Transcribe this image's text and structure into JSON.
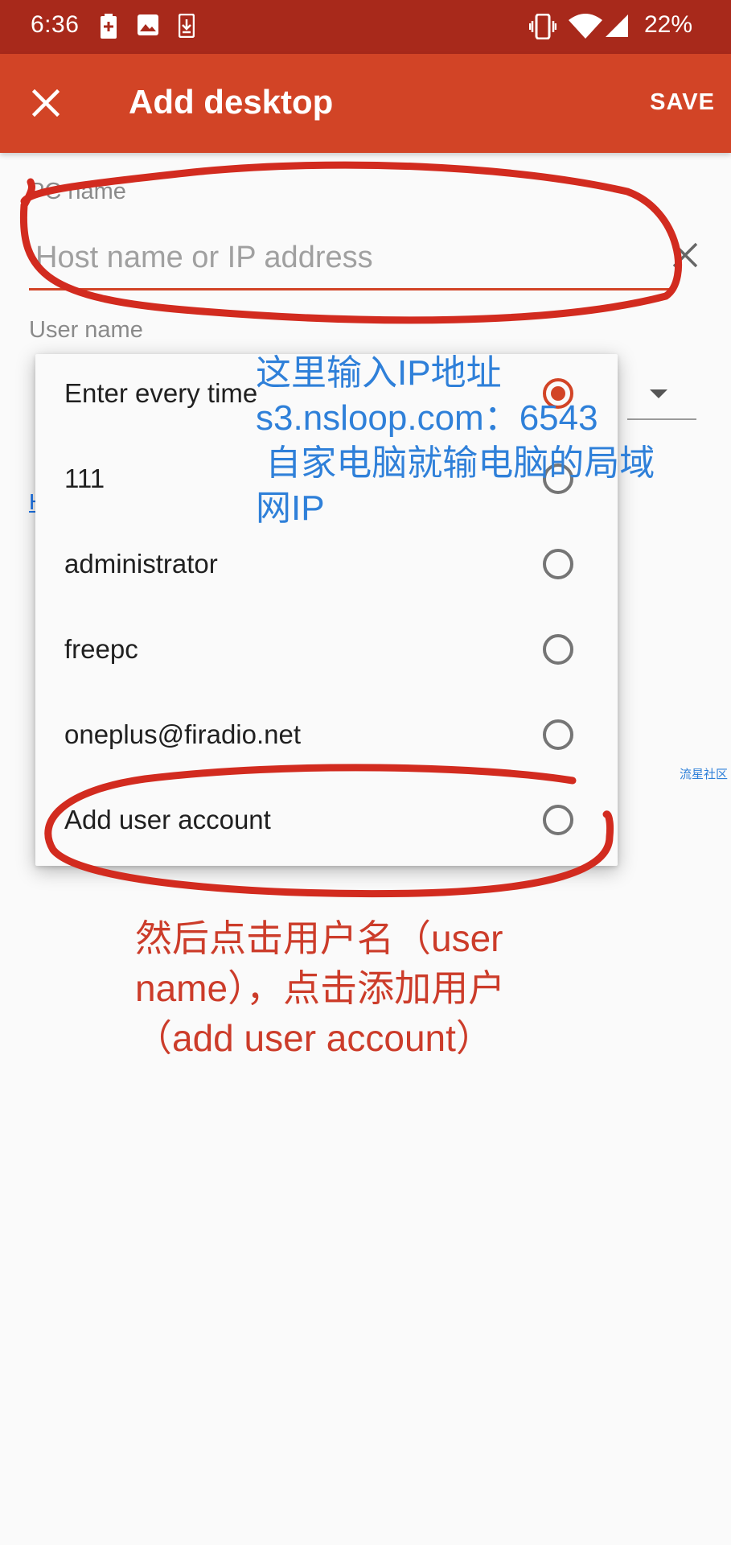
{
  "status_bar": {
    "time": "6:36",
    "left_icons": [
      "battery-saver-icon",
      "image-icon",
      "download-icon"
    ],
    "right_icons": [
      "vibrate-icon",
      "wifi-icon",
      "signal-icon"
    ],
    "battery": "22%"
  },
  "app_bar": {
    "close_icon": "close-icon",
    "title": "Add desktop",
    "save_label": "SAVE"
  },
  "form": {
    "pc_name_label": "PC name",
    "pc_name_placeholder": "Host name or IP address",
    "pc_name_value": "",
    "clear_icon": "close-icon",
    "user_name_label": "User name",
    "hidden_link_text": "H"
  },
  "user_menu": {
    "items": [
      {
        "label": "Enter every time",
        "selected": true
      },
      {
        "label": "111",
        "selected": false
      },
      {
        "label": "administrator",
        "selected": false
      },
      {
        "label": "freepc",
        "selected": false
      },
      {
        "label": "oneplus@firadio.net",
        "selected": false
      },
      {
        "label": "Add user account",
        "selected": false
      }
    ]
  },
  "annotations": {
    "blue_lines": [
      "这里输入IP地址",
      "s3.nsloop.com：6543",
      " 自家电脑就输电脑的局域",
      "网IP"
    ],
    "red_lines": [
      "然后点击用户名（user",
      "name），点击添加用户",
      "（add user account）"
    ],
    "watermark": "流星社区"
  },
  "colors": {
    "status_bar": "#a8291b",
    "app_bar": "#d24426",
    "accent": "#d24426",
    "annotation_blue": "#2f80d9",
    "annotation_red": "#cc3c2a",
    "scribble_red": "#d22b1f"
  }
}
